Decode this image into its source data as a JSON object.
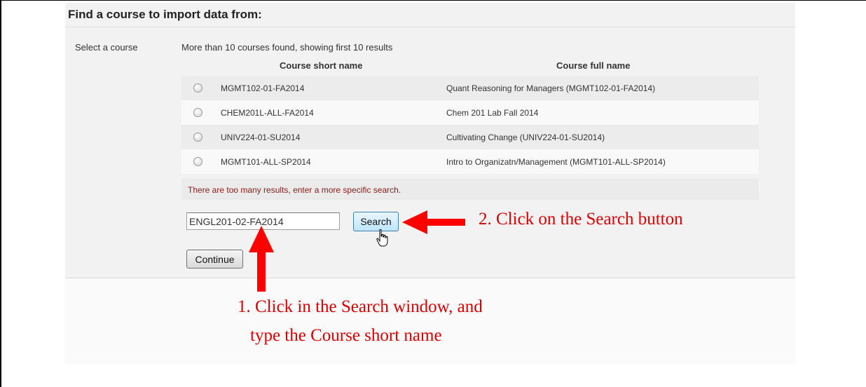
{
  "section": {
    "title": "Find a course to import data from:"
  },
  "select": {
    "label": "Select a course",
    "summary": "More than 10 courses found, showing first 10 results"
  },
  "table": {
    "columns": [
      "Course short name",
      "Course full name"
    ],
    "rows": [
      {
        "short": "MGMT102-01-FA2014",
        "full": "Quant Reasoning for Managers (MGMT102-01-FA2014)"
      },
      {
        "short": "CHEM201L-ALL-FA2014",
        "full": "Chem 201 Lab Fall 2014"
      },
      {
        "short": "UNIV224-01-SU2014",
        "full": "Cultivating Change (UNIV224-01-SU2014)"
      },
      {
        "short": "MGMT101-ALL-SP2014",
        "full": "Intro to Organizatn/Management (MGMT101-ALL-SP2014)"
      }
    ],
    "warning": "There are too many results, enter a more specific search."
  },
  "search": {
    "value": "ENGL201-02-FA2014",
    "button_label": "Search"
  },
  "continue_label": "Continue",
  "annotations": {
    "step2": "2. Click on the Search button",
    "step1_line1": "1. Click in the Search window, and",
    "step1_line2": "type the Course short name"
  },
  "colors": {
    "annotation": "#e00000",
    "warning_text": "#8b1a1a",
    "search_button_border": "#3c7fb1"
  }
}
